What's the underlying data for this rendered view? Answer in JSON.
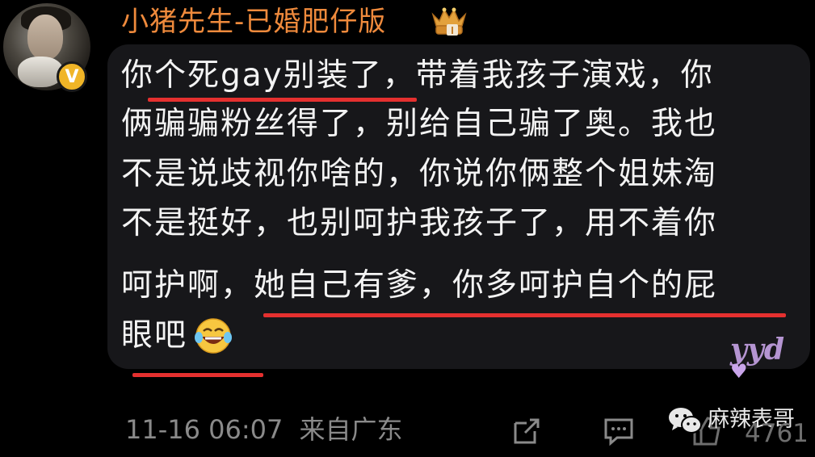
{
  "post": {
    "username": "小猪先生-已婚肥仔版",
    "verified_badge": "V",
    "crown_icon": "crown-badge-icon",
    "lines": [
      "你个死gay别装了，带着我孩子演戏，你",
      "俩骗骗粉丝得了，别给自己骗了奥。我也",
      "不是说歧视你啥的，你说你俩整个姐妹淘",
      "不是挺好，也别呵护我孩子了，用不着你",
      "呵护啊，她自己有爹，你多呵护自个的屁",
      "眼吧"
    ],
    "emoji": "laughing-crying-emoji",
    "timestamp": "11-16 06:07",
    "location": "来自广东",
    "repost_count": "4761"
  },
  "watermarks": {
    "corner_text": "yyd",
    "brand": "麻辣表哥"
  },
  "colors": {
    "username": "#ef8a3c",
    "underline": "#e5302f",
    "bubble": "#17171a",
    "verified": "#f0b527",
    "meta": "#8a8a8a"
  }
}
